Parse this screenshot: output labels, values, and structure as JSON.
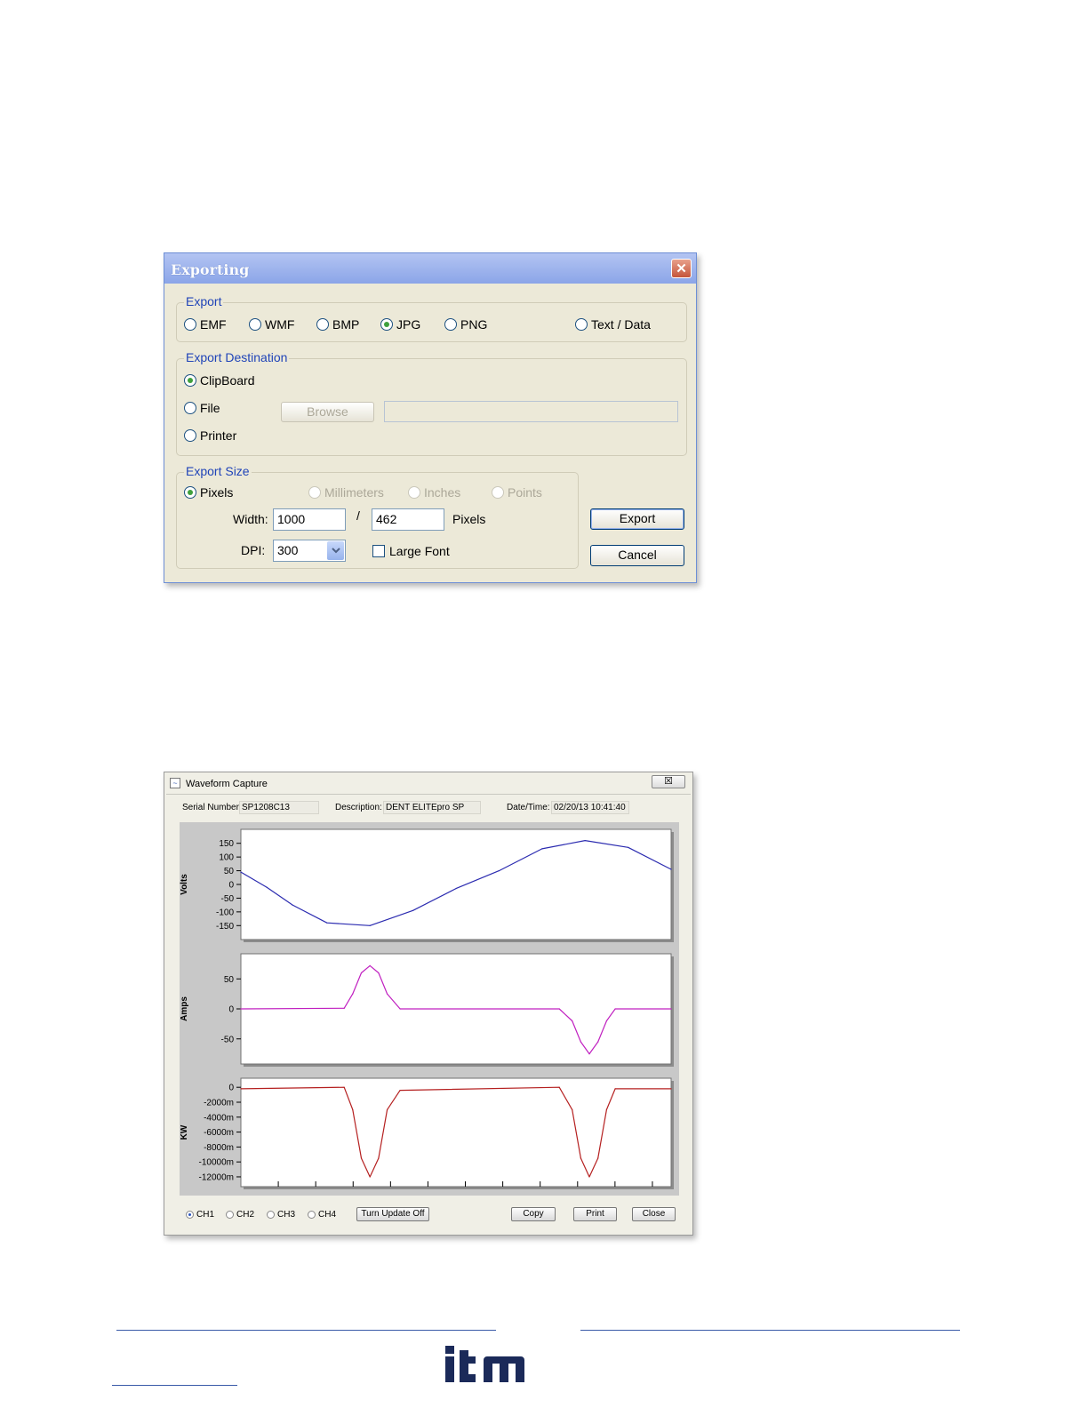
{
  "export_dialog": {
    "title": "Exporting",
    "close_glyph": "✕",
    "export_group": {
      "legend": "Export",
      "formats": [
        {
          "label": "EMF",
          "selected": false
        },
        {
          "label": "WMF",
          "selected": false
        },
        {
          "label": "BMP",
          "selected": false
        },
        {
          "label": "JPG",
          "selected": true
        },
        {
          "label": "PNG",
          "selected": false
        },
        {
          "label": "Text / Data",
          "selected": false
        }
      ]
    },
    "destination_group": {
      "legend": "Export Destination",
      "options": [
        {
          "label": "ClipBoard",
          "selected": true
        },
        {
          "label": "File",
          "selected": false
        },
        {
          "label": "Printer",
          "selected": false
        }
      ],
      "browse_label": "Browse",
      "path_value": ""
    },
    "size_group": {
      "legend": "Export Size",
      "units": [
        {
          "label": "Pixels",
          "selected": true,
          "enabled": true
        },
        {
          "label": "Millimeters",
          "selected": false,
          "enabled": false
        },
        {
          "label": "Inches",
          "selected": false,
          "enabled": false
        },
        {
          "label": "Points",
          "selected": false,
          "enabled": false
        }
      ],
      "width_label": "Width:",
      "width_value": "1000",
      "separator": "/",
      "height_value": "462",
      "unit_label": "Pixels",
      "dpi_label": "DPI:",
      "dpi_value": "300",
      "large_font_label": "Large Font",
      "large_font_checked": false
    },
    "export_button": "Export",
    "cancel_button": "Cancel"
  },
  "waveform_window": {
    "title": "Waveform Capture",
    "close_glyph": "☒",
    "serial_label": "Serial Number:",
    "serial_value": "SP1208C13",
    "description_label": "Description:",
    "description_value": "DENT ELITEpro SP",
    "datetime_label": "Date/Time:",
    "datetime_value": "02/20/13 10:41:40",
    "channels": [
      {
        "label": "CH1",
        "selected": true
      },
      {
        "label": "CH2",
        "selected": false
      },
      {
        "label": "CH3",
        "selected": false
      },
      {
        "label": "CH4",
        "selected": false
      }
    ],
    "update_button": "Turn Update Off",
    "copy_button": "Copy",
    "print_button": "Print",
    "close_button": "Close"
  },
  "chart_data": [
    {
      "type": "line",
      "ylabel": "Volts",
      "yticks": [
        "150",
        "100",
        "50",
        "0",
        "-50",
        "-100",
        "-150"
      ],
      "ylim": [
        -175,
        175
      ],
      "color": "#2b2bb0",
      "series": [
        {
          "x": [
            0,
            6,
            12,
            20,
            30,
            40,
            50,
            60,
            70,
            80,
            90,
            100
          ],
          "values": [
            45,
            -10,
            -75,
            -140,
            -150,
            -95,
            -15,
            50,
            130,
            160,
            135,
            55
          ]
        }
      ]
    },
    {
      "type": "line",
      "ylabel": "Amps",
      "yticks": [
        "50",
        "0",
        "-50"
      ],
      "ylim": [
        -80,
        80
      ],
      "color": "#c020c0",
      "series": [
        {
          "x": [
            0,
            24,
            26,
            28,
            30,
            32,
            34,
            37,
            74,
            77,
            79,
            81,
            83,
            85,
            87,
            100
          ],
          "values": [
            0,
            1,
            25,
            60,
            72,
            60,
            25,
            0,
            0,
            -20,
            -55,
            -75,
            -55,
            -20,
            0,
            0
          ]
        }
      ]
    },
    {
      "type": "line",
      "ylabel": "KW",
      "yticks": [
        "0",
        "-2000m",
        "-4000m",
        "-6000m",
        "-8000m",
        "-10000m",
        "-12000m"
      ],
      "ylim": [
        -12600,
        500
      ],
      "color": "#b52020",
      "series": [
        {
          "x": [
            0,
            24,
            26,
            28,
            30,
            32,
            34,
            37,
            74,
            77,
            79,
            81,
            83,
            85,
            87,
            100
          ],
          "values": [
            -200,
            0,
            -3000,
            -9500,
            -12000,
            -9500,
            -3000,
            -400,
            0,
            -3000,
            -9500,
            -12000,
            -9500,
            -3000,
            -200,
            -200
          ]
        }
      ]
    }
  ],
  "footer": {
    "logo": "itm"
  }
}
